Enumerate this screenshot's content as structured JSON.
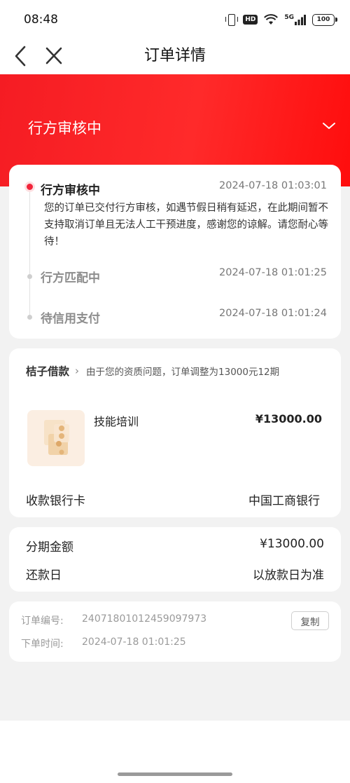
{
  "status_bar": {
    "time": "08:48",
    "network": "5G",
    "hd": "HD",
    "battery": "100"
  },
  "nav": {
    "title": "订单详情",
    "back_icon": "chevron-left-icon",
    "close_icon": "close-icon"
  },
  "hero": {
    "status": "行方审核中",
    "toggle_icon": "chevron-down-icon"
  },
  "timeline": [
    {
      "title": "行方审核中",
      "time": "2024-07-18 01:03:01",
      "description": "您的订单已交付行方审核，如遇节假日稍有延迟，在此期间暂不支持取消订单且无法人工干预进度，感谢您的谅解。请您耐心等待！"
    },
    {
      "title": "行方匹配中",
      "time": "2024-07-18 01:01:25"
    },
    {
      "title": "待信用支付",
      "time": "2024-07-18 01:01:24"
    }
  ],
  "product_card": {
    "merchant": "桔子借款",
    "merchant_chevron": "›",
    "note": "由于您的资质问题，订单调整为13000元12期",
    "product_name": "技能培训",
    "product_price": "¥13000.00",
    "bank_label": "收款银行卡",
    "bank_value": "中国工商银行"
  },
  "installment": {
    "amount_label": "分期金额",
    "amount_value": "¥13000.00",
    "repay_label": "还款日",
    "repay_value": "以放款日为准"
  },
  "order_info": {
    "number_label": "订单编号:",
    "number_value": "24071801012459097973",
    "copy_label": "复制",
    "time_label": "下单时间:",
    "time_value": "2024-07-18 01:01:25"
  },
  "colors": {
    "accent_red": "#f51c23",
    "active_dot": "#f2243a",
    "background": "#f2f2f2"
  }
}
